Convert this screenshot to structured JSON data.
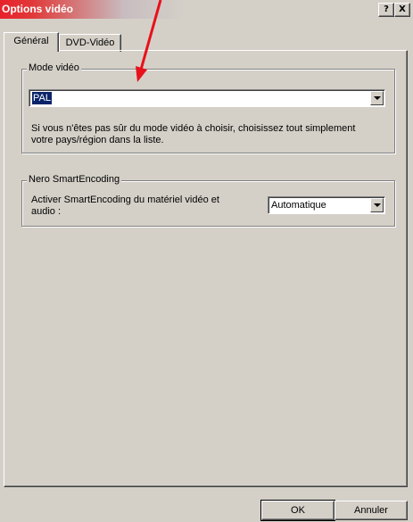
{
  "window": {
    "title": "Options vidéo",
    "help_label": "?",
    "close_label": "X"
  },
  "tabs": [
    {
      "label": "Général",
      "active": true
    },
    {
      "label": "DVD-Vidéo",
      "active": false
    }
  ],
  "video_mode": {
    "group_label": "Mode vidéo",
    "selected": "PAL",
    "help_text_line1": "Si vous n'êtes pas sûr du mode vidéo à choisir, choisissez tout simplement",
    "help_text_line2": "votre pays/région dans la liste."
  },
  "smart_encoding": {
    "group_label": "Nero SmartEncoding",
    "label_line1": "Activer SmartEncoding du matériel vidéo et",
    "label_line2": "audio :",
    "selected": "Automatique"
  },
  "buttons": {
    "ok": "OK",
    "cancel": "Annuler"
  },
  "colors": {
    "annotation_arrow": "#ff0000",
    "selection": "#0a246a",
    "dialog_bg": "#d4d0c8"
  }
}
